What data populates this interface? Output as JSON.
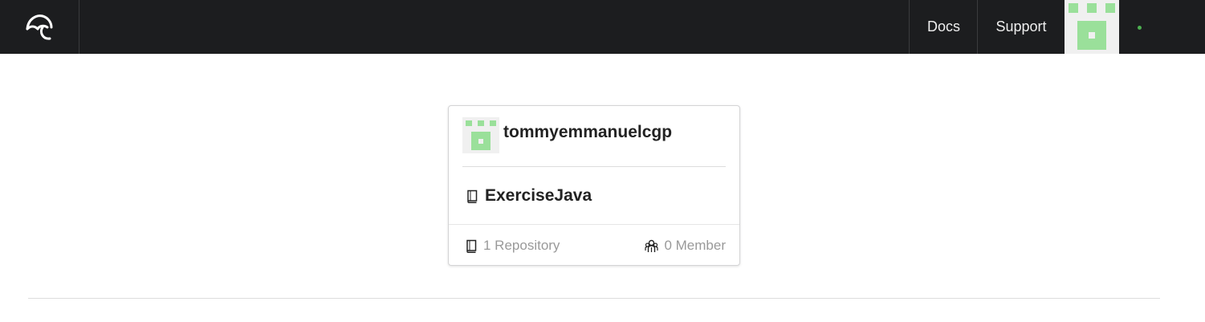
{
  "header": {
    "logo_icon": "umbrella-logo-icon",
    "nav": {
      "docs_label": "Docs",
      "support_label": "Support"
    },
    "user_avatar_icon": "identicon-avatar",
    "status_color": "#4caf50"
  },
  "card": {
    "owner": "tommyemmanuelcgp",
    "repository": "ExerciseJava",
    "repo_icon": "book-icon",
    "repo_count_label": "1 Repository",
    "member_count_label": "0 Member",
    "member_icon": "users-icon"
  },
  "colors": {
    "topbar": "#1c1d1f",
    "identicon_green": "#9ae09a",
    "muted_text": "#999999"
  }
}
